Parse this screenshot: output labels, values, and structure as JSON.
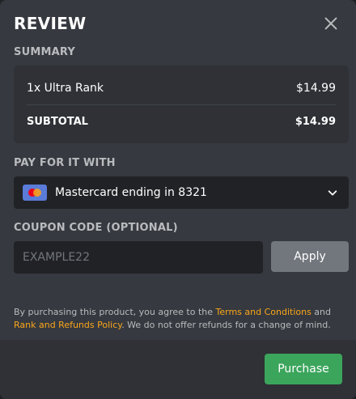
{
  "header": {
    "title": "REVIEW"
  },
  "summary": {
    "label": "SUMMARY",
    "item_name": "1x Ultra Rank",
    "item_price": "$14.99",
    "subtotal_label": "SUBTOTAL",
    "subtotal_value": "$14.99"
  },
  "payment": {
    "label": "PAY FOR IT WITH",
    "method": "Mastercard ending in 8321"
  },
  "coupon": {
    "label": "COUPON CODE (OPTIONAL)",
    "placeholder": "EXAMPLE22",
    "value": "",
    "apply_label": "Apply"
  },
  "legal": {
    "prefix": "By purchasing this product, you agree to the ",
    "terms_link": "Terms and Conditions",
    "and": " and ",
    "refunds_link": "Rank and Refunds Policy",
    "suffix": ". We do not offer refunds for a change of mind."
  },
  "footer": {
    "purchase_label": "Purchase"
  },
  "colors": {
    "background": "#36393f",
    "panel": "#2f3136",
    "input": "#202225",
    "link": "#faa61a",
    "primary": "#3ba55c",
    "secondary": "#72767d"
  }
}
